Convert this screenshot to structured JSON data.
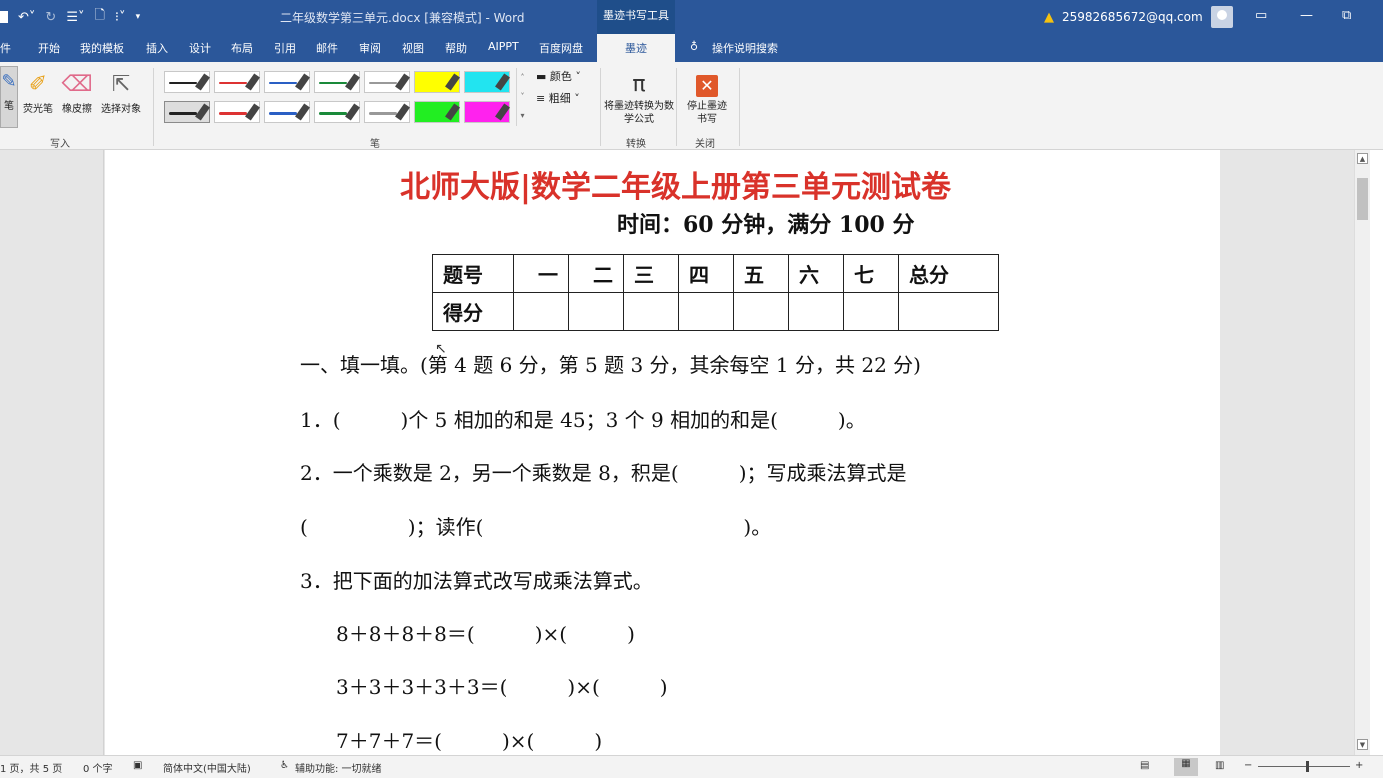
{
  "titlebar": {
    "doc_title": "二年级数学第三单元.docx [兼容模式]  -  Word",
    "contextual_tab": "墨迹书写工具",
    "account": "25982685672@qq.com"
  },
  "tabs": [
    "件",
    "开始",
    "我的模板",
    "插入",
    "设计",
    "布局",
    "引用",
    "邮件",
    "审阅",
    "视图",
    "帮助",
    "AIPPT",
    "百度网盘",
    "墨迹",
    "操作说明搜索"
  ],
  "ribbon": {
    "write_group": {
      "label": "写入",
      "tools": [
        "笔",
        "荧光笔",
        "橡皮擦",
        "选择对象"
      ]
    },
    "pen_group": {
      "label": "笔",
      "color_label": "颜色",
      "thickness_label": "粗细"
    },
    "convert_group": {
      "label": "转换",
      "button": "将墨迹转换为数学公式"
    },
    "close_group": {
      "label": "关闭",
      "button": "停止墨迹书写"
    }
  },
  "document": {
    "title": "北师大版|数学二年级上册第三单元测试卷",
    "subtitle": "时间：60 分钟，满分 100 分",
    "score_table": {
      "header": [
        "题号",
        "一",
        "二",
        "三",
        "四",
        "五",
        "六",
        "七",
        "总分"
      ],
      "row_label": "得分"
    },
    "lines": [
      "一、填一填。(第 4 题 6 分，第 5 题 3 分，其余每空 1 分，共 22 分)",
      "1．(　　　)个 5 相加的和是 45；3 个 9 相加的和是(　　　)。",
      "2．一个乘数是 2，另一个乘数是 8，积是(　　　)；写成乘法算式是",
      "(　　　　　)；读作(　　　　　　　　　　　　　)。",
      "3．把下面的加法算式改写成乘法算式。",
      "8＋8＋8＋8＝(　　　)×(　　　)",
      "3＋3＋3＋3＋3＝(　　　)×(　　　)",
      "7＋7＋7＝(　　　)×(　　　)"
    ]
  },
  "statusbar": {
    "page": "1 页，共 5 页",
    "words": "0 个字",
    "language": "简体中文(中国大陆)",
    "accessibility": "辅助功能: 一切就绪"
  },
  "colors": {
    "word_blue": "#2b579a",
    "title_red": "#d9322a"
  }
}
